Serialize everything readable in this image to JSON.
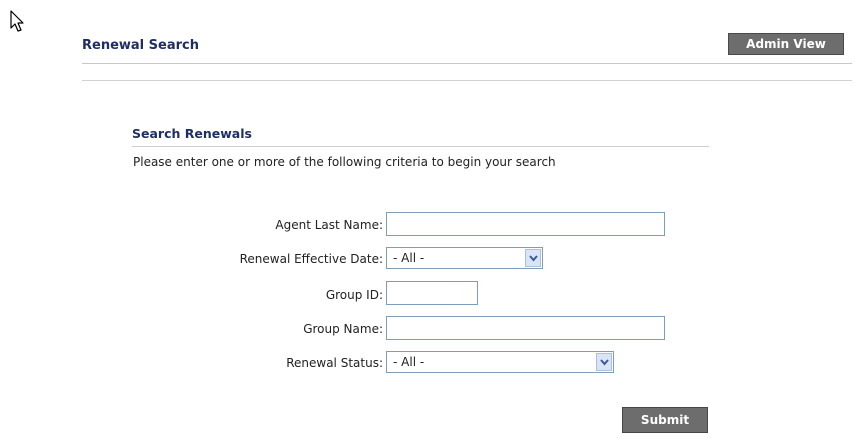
{
  "header": {
    "title": "Renewal Search",
    "admin_view_label": "Admin View"
  },
  "search_section": {
    "title": "Search Renewals",
    "instructions": "Please enter one or more of the following criteria to begin your search"
  },
  "form": {
    "agent_last_name": {
      "label": "Agent Last Name:",
      "value": ""
    },
    "renewal_effective_date": {
      "label": "Renewal Effective Date:",
      "selected": "- All -"
    },
    "group_id": {
      "label": "Group ID:",
      "value": ""
    },
    "group_name": {
      "label": "Group Name:",
      "value": ""
    },
    "renewal_status": {
      "label": "Renewal Status:",
      "selected": "- All -"
    },
    "submit_label": "Submit"
  },
  "icons": {
    "cursor": "mouse-pointer-icon",
    "dropdown": "chevron-down-icon"
  },
  "colors": {
    "heading": "#1f2f63",
    "button_bg": "#6d6d6d",
    "input_border": "#7f9db9"
  }
}
